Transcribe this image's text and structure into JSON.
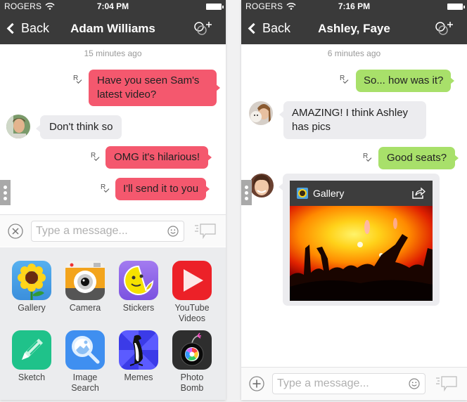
{
  "left_screen": {
    "status": {
      "carrier": "ROGERS",
      "time": "7:04 PM"
    },
    "nav": {
      "back_label": "Back",
      "title": "Adam Williams"
    },
    "timestamp": "15 minutes ago",
    "messages": [
      {
        "direction": "outgoing",
        "text_line1": "Have you seen Sam's",
        "text_line2": "latest video?",
        "receipt": "R"
      },
      {
        "direction": "incoming",
        "text": "Don't think so"
      },
      {
        "direction": "outgoing",
        "text": "OMG it's hilarious!",
        "receipt": "R"
      },
      {
        "direction": "outgoing",
        "text": "I'll send it to you",
        "receipt": "R"
      }
    ],
    "composer": {
      "placeholder": "Type a message..."
    },
    "apps": [
      {
        "label": "Gallery",
        "icon": "sunflower-icon"
      },
      {
        "label": "Camera",
        "icon": "camera-icon"
      },
      {
        "label": "Stickers",
        "icon": "sticker-smiley-icon"
      },
      {
        "label_line1": "YouTube",
        "label_line2": "Videos",
        "icon": "play-icon"
      },
      {
        "label": "Sketch",
        "icon": "pencil-icon"
      },
      {
        "label_line1": "Image",
        "label_line2": "Search",
        "icon": "magnifier-image-icon"
      },
      {
        "label": "Memes",
        "icon": "penguin-icon"
      },
      {
        "label_line1": "Photo",
        "label_line2": "Bomb",
        "icon": "bomb-icon"
      }
    ]
  },
  "right_screen": {
    "status": {
      "carrier": "ROGERS",
      "time": "7:16 PM"
    },
    "nav": {
      "back_label": "Back",
      "title": "Ashley, Faye"
    },
    "timestamp": "6 minutes ago",
    "messages": [
      {
        "direction": "outgoing",
        "text": "So... how was it?",
        "receipt": "R"
      },
      {
        "direction": "incoming",
        "text_line1": "AMAZING! I think Ashley",
        "text_line2": "has pics"
      },
      {
        "direction": "outgoing",
        "text": "Good seats?",
        "receipt": "R"
      }
    ],
    "gallery_card": {
      "title": "Gallery"
    },
    "composer": {
      "placeholder": "Type a message..."
    }
  },
  "colors": {
    "nav_bg": "#3a3a3a",
    "bubble_red": "#f4586e",
    "bubble_green": "#a8e06a",
    "bubble_incoming": "#ececef",
    "tray_bg": "#ebecee"
  }
}
